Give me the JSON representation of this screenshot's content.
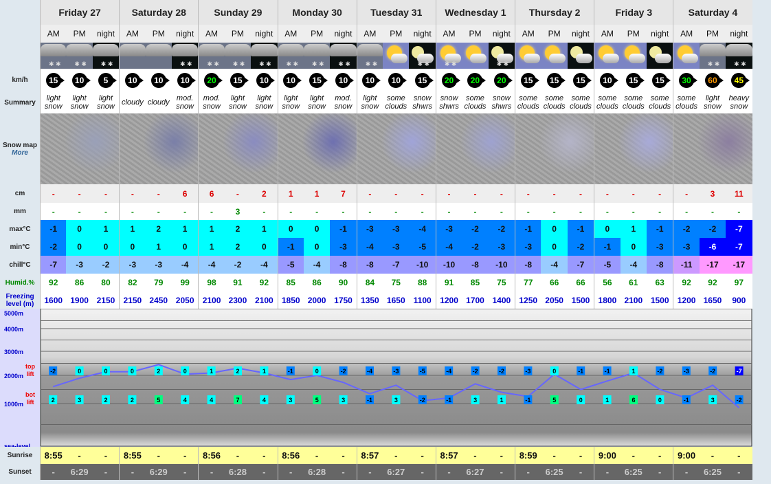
{
  "days": [
    "Friday 27",
    "Saturday 28",
    "Sunday 29",
    "Monday 30",
    "Tuesday 31",
    "Wednesday 1",
    "Thursday 2",
    "Friday 3",
    "Saturday 4"
  ],
  "periods": [
    "AM",
    "PM",
    "night"
  ],
  "labels": {
    "wind": "km/h",
    "summary": "Summary",
    "snow_map": "Snow map",
    "more_link": "More",
    "snow": "cm",
    "rain": "mm",
    "max": "max°C",
    "min": "min°C",
    "chill": "chill°C",
    "humid": "Humid.%",
    "freezing": "Freezing level (m)",
    "sunrise": "Sunrise",
    "sunset": "Sunset",
    "top_lift": "top lift",
    "bot_lift": "bot lift",
    "elev": [
      "5000m",
      "4000m",
      "3000m",
      "2000m",
      "1000m",
      "sea-level"
    ]
  },
  "icons": [
    "cloud-snow",
    "cloud-snow",
    "cloud-snow-night",
    "cloud",
    "cloud",
    "cloud-snow-night",
    "cloud-snow",
    "cloud-snow",
    "cloud-snow-night",
    "cloud-snow",
    "cloud-snow",
    "cloud-snow-night",
    "cloud-snow",
    "sun-cloud",
    "moon-cloud-snow",
    "sun-cloud-snow",
    "sun-cloud",
    "moon-cloud-snow",
    "sun-cloud",
    "sun-cloud",
    "moon-cloud",
    "sun-cloud",
    "sun-cloud",
    "moon-cloud",
    "sun-cloud",
    "cloud-snow",
    "cloud-snow-night"
  ],
  "wind": [
    "15",
    "10",
    "5",
    "10",
    "10",
    "10",
    "20",
    "15",
    "10",
    "10",
    "15",
    "10",
    "10",
    "10",
    "15",
    "20",
    "20",
    "20",
    "15",
    "15",
    "15",
    "10",
    "15",
    "15",
    "30",
    "60",
    "45"
  ],
  "wind_colors": {
    "5": "#fff",
    "10": "#fff",
    "15": "#fff",
    "20": "#0f0",
    "30": "#0f0",
    "45": "#ff0",
    "60": "#f90"
  },
  "summary": [
    "light snow",
    "light snow",
    "light snow",
    "cloudy",
    "cloudy",
    "mod. snow",
    "mod. snow",
    "light snow",
    "light snow",
    "light snow",
    "light snow",
    "mod. snow",
    "light snow",
    "some clouds",
    "snow shwrs",
    "snow shwrs",
    "some clouds",
    "snow shwrs",
    "some clouds",
    "some clouds",
    "some clouds",
    "some clouds",
    "some clouds",
    "some clouds",
    "some clouds",
    "light snow",
    "heavy snow"
  ],
  "snow_cm": [
    "-",
    "-",
    "-",
    "-",
    "-",
    "6",
    "6",
    "-",
    "2",
    "1",
    "1",
    "7",
    "-",
    "-",
    "-",
    "-",
    "-",
    "-",
    "-",
    "-",
    "-",
    "-",
    "-",
    "-",
    "-",
    "3",
    "11"
  ],
  "rain_mm": [
    "-",
    "-",
    "-",
    "-",
    "-",
    "-",
    "-",
    "3",
    "-",
    "-",
    "-",
    "-",
    "-",
    "-",
    "-",
    "-",
    "-",
    "-",
    "-",
    "-",
    "-",
    "-",
    "-",
    "-",
    "-",
    "-",
    "-"
  ],
  "max_c": [
    "-1",
    "0",
    "1",
    "1",
    "2",
    "1",
    "1",
    "2",
    "1",
    "0",
    "0",
    "-1",
    "-3",
    "-3",
    "-4",
    "-3",
    "-2",
    "-2",
    "-1",
    "0",
    "-1",
    "0",
    "1",
    "-1",
    "-2",
    "-2",
    "-7"
  ],
  "min_c": [
    "-2",
    "0",
    "0",
    "0",
    "1",
    "0",
    "1",
    "2",
    "0",
    "-1",
    "0",
    "-3",
    "-4",
    "-3",
    "-5",
    "-4",
    "-2",
    "-3",
    "-3",
    "0",
    "-2",
    "-1",
    "0",
    "-3",
    "-3",
    "-6",
    "-7"
  ],
  "chill_c": [
    "-7",
    "-3",
    "-2",
    "-3",
    "-3",
    "-4",
    "-4",
    "-2",
    "-4",
    "-5",
    "-4",
    "-8",
    "-8",
    "-7",
    "-10",
    "-10",
    "-8",
    "-10",
    "-8",
    "-4",
    "-7",
    "-5",
    "-4",
    "-8",
    "-11",
    "-17",
    "-17"
  ],
  "humidity": [
    "92",
    "86",
    "80",
    "82",
    "79",
    "99",
    "98",
    "91",
    "92",
    "85",
    "86",
    "90",
    "84",
    "75",
    "88",
    "91",
    "85",
    "75",
    "77",
    "66",
    "66",
    "56",
    "61",
    "63",
    "92",
    "92",
    "97"
  ],
  "freezing": [
    "1600",
    "1900",
    "2150",
    "2150",
    "2450",
    "2050",
    "2100",
    "2300",
    "2100",
    "1850",
    "2000",
    "1750",
    "1350",
    "1650",
    "1100",
    "1200",
    "1700",
    "1400",
    "1250",
    "2050",
    "1500",
    "1800",
    "2100",
    "1500",
    "1200",
    "1650",
    "900"
  ],
  "top_lift": [
    "-2",
    "0",
    "0",
    "0",
    "2",
    "0",
    "1",
    "2",
    "1",
    "-1",
    "0",
    "-2",
    "-4",
    "-3",
    "-5",
    "-4",
    "-2",
    "-2",
    "-3",
    "0",
    "-1",
    "-1",
    "1",
    "-2",
    "-3",
    "-2",
    "-7"
  ],
  "bot_lift": [
    "2",
    "3",
    "2",
    "2",
    "5",
    "4",
    "4",
    "7",
    "4",
    "3",
    "5",
    "3",
    "-1",
    "3",
    "-2",
    "-1",
    "3",
    "1",
    "-1",
    "5",
    "0",
    "1",
    "6",
    "0",
    "-1",
    "3",
    "-2"
  ],
  "sunrise": [
    "8:55",
    "-",
    "-",
    "8:55",
    "-",
    "-",
    "8:56",
    "-",
    "-",
    "8:56",
    "-",
    "-",
    "8:57",
    "-",
    "-",
    "8:57",
    "-",
    "-",
    "8:59",
    "-",
    "-",
    "9:00",
    "-",
    "-",
    "9:00",
    "-",
    "-"
  ],
  "sunset": [
    "-",
    "6:29",
    "-",
    "-",
    "6:29",
    "-",
    "-",
    "6:28",
    "-",
    "-",
    "6:28",
    "-",
    "-",
    "6:27",
    "-",
    "-",
    "6:27",
    "-",
    "-",
    "6:25",
    "-",
    "-",
    "6:25",
    "-",
    "-",
    "6:25",
    "-"
  ],
  "colors": {
    "freezing_line": "#6666ff",
    "chill_mild": "#99ccff",
    "chill_cold": "#9999ff",
    "chill_colder": "#cc99ff",
    "chill_coldest": "#ff99ff",
    "temp_warm": "#00ffff",
    "temp_cold": "#0080ff",
    "temp_vcold": "#0000ff",
    "temp_green": "#00ff80"
  }
}
